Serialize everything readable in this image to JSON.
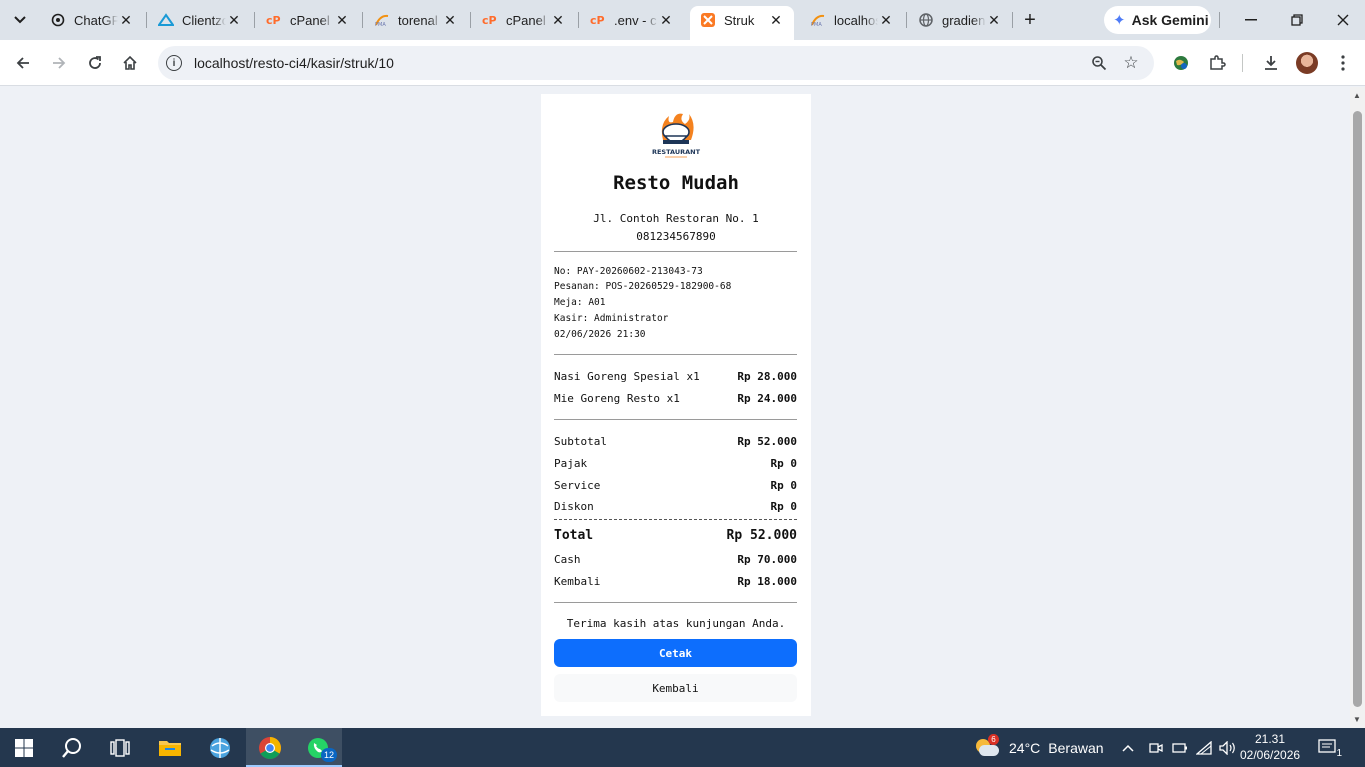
{
  "browser": {
    "tabs": [
      {
        "title": "ChatGPT",
        "icon": "chatgpt-icon"
      },
      {
        "title": "Clientzone",
        "icon": "clientzone-icon"
      },
      {
        "title": "cPanel",
        "icon": "cpanel-icon"
      },
      {
        "title": "torenal",
        "icon": "phpmyadmin-icon"
      },
      {
        "title": "cPanel",
        "icon": "cpanel-icon"
      },
      {
        "title": ".env - c",
        "icon": "cpanel-icon"
      },
      {
        "title": "Struk",
        "icon": "xampp-icon",
        "active": true
      },
      {
        "title": "localhost",
        "icon": "phpmyadmin-icon"
      },
      {
        "title": "gradien",
        "icon": "globe-icon"
      }
    ],
    "gemini_label": "Ask Gemini",
    "url": "localhost/resto-ci4/kasir/struk/10"
  },
  "receipt": {
    "name": "Resto Mudah",
    "logo_text": "RESTAURANT",
    "address": "Jl. Contoh Restoran No. 1",
    "phone": "081234567890",
    "meta": {
      "no": "No: PAY-20260602-213043-73",
      "order": "Pesanan: POS-20260529-182900-68",
      "table": "Meja: A01",
      "cashier": "Kasir: Administrator",
      "datetime": "02/06/2026 21:30"
    },
    "items": [
      {
        "name": "Nasi Goreng Spesial x1",
        "price": "Rp 28.000"
      },
      {
        "name": "Mie Goreng Resto x1",
        "price": "Rp 24.000"
      }
    ],
    "summary": {
      "subtotal_label": "Subtotal",
      "subtotal": "Rp 52.000",
      "tax_label": "Pajak",
      "tax": "Rp 0",
      "service_label": "Service",
      "service": "Rp 0",
      "discount_label": "Diskon",
      "discount": "Rp 0",
      "total_label": "Total",
      "total": "Rp 52.000",
      "cash_label": "Cash",
      "cash": "Rp 70.000",
      "change_label": "Kembali",
      "change": "Rp 18.000"
    },
    "thanks": "Terima kasih atas kunjungan Anda.",
    "print_label": "Cetak",
    "back_label": "Kembali"
  },
  "taskbar": {
    "whatsapp_badge": "12",
    "weather_badge": "6",
    "weather_temp": "24°C",
    "weather_desc": "Berawan",
    "time": "21.31",
    "date": "02/06/2026",
    "notif_count": "1"
  },
  "colors": {
    "primary_button": "#0d6efd",
    "tabstrip": "#dde3ea",
    "taskbar": "#24374e"
  }
}
